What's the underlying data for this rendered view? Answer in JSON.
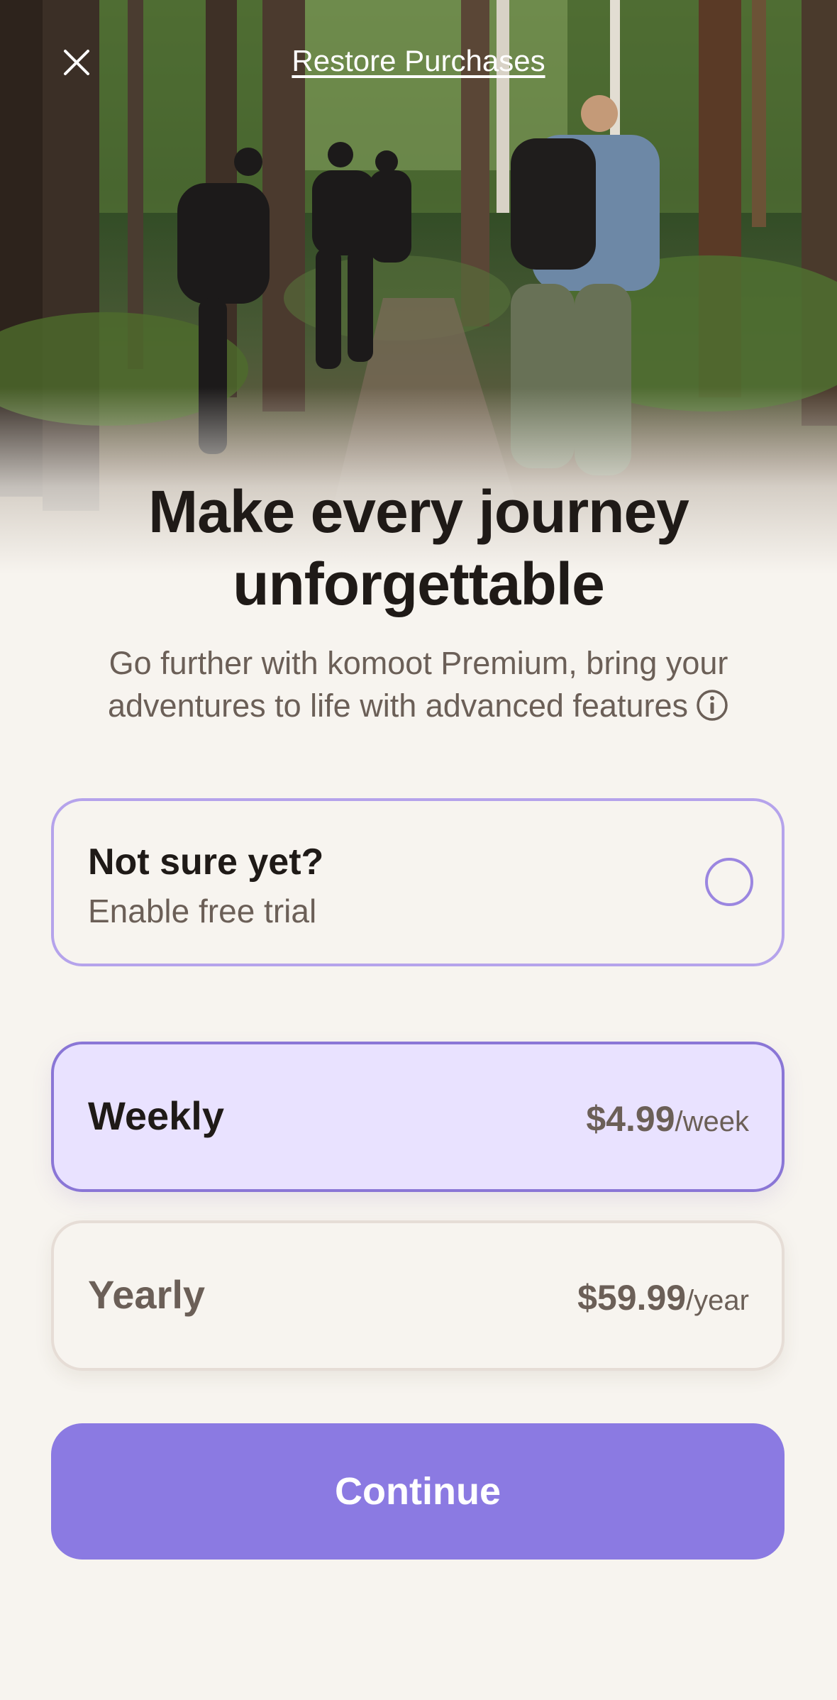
{
  "header": {
    "restore_label": "Restore Purchases",
    "close_icon": "close-icon"
  },
  "hero": {
    "image": "hikers-on-forest-trail",
    "title": "Make every journey unforgettable",
    "subtitle": "Go further with komoot Premium, bring your adventures to life with advanced features",
    "info_icon": "info-icon"
  },
  "trial": {
    "title": "Not sure yet?",
    "subtitle": "Enable free trial",
    "enabled": false
  },
  "plans": [
    {
      "name": "Weekly",
      "price": "$4.99",
      "period": "/week",
      "selected": true
    },
    {
      "name": "Yearly",
      "price": "$59.99",
      "period": "/year",
      "selected": false
    }
  ],
  "cta": {
    "label": "Continue"
  },
  "colors": {
    "accent": "#8b7ae2",
    "selected_bg": "#e9e2ff",
    "background": "#f7f4ef",
    "text": "#1f1a17",
    "muted_text": "#6b5f57"
  }
}
